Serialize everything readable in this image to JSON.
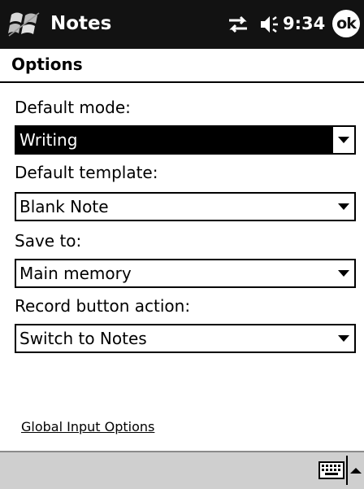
{
  "titlebar": {
    "app_title": "Notes",
    "start_icon": "windows-flag-icon",
    "connectivity_icon": "connectivity-arrows-icon",
    "volume_icon": "speaker-volume-icon",
    "time": "9:34",
    "ok_label": "ok"
  },
  "header": {
    "title": "Options"
  },
  "form": {
    "fields": [
      {
        "label": "Default mode:",
        "value": "Writing",
        "selected": true
      },
      {
        "label": "Default template:",
        "value": "Blank Note",
        "selected": false
      },
      {
        "label": "Save to:",
        "value": "Main memory",
        "selected": false
      },
      {
        "label": "Record button action:",
        "value": "Switch to Notes",
        "selected": false
      }
    ]
  },
  "link": {
    "global_input_options": "Global Input Options"
  },
  "menubar": {
    "keyboard_icon": "keyboard-icon",
    "sip_arrow_icon": "sip-arrow-up-icon"
  },
  "colors": {
    "titlebar_bg": "#121212",
    "menubar_bg": "#cfcfcf",
    "selection_bg": "#000000"
  }
}
